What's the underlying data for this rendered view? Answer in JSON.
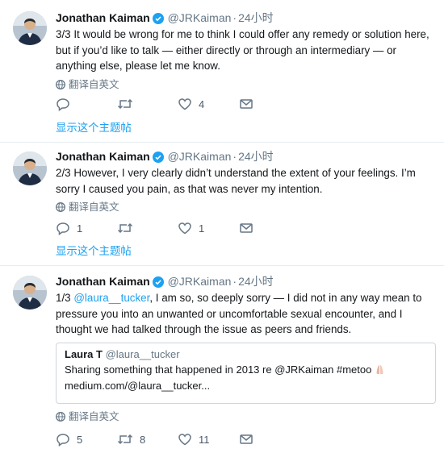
{
  "tweets": [
    {
      "name": "Jonathan Kaiman",
      "handle": "@JRKaiman",
      "time": "24小时",
      "text": "3/3 It would be wrong for me to think I could offer any remedy or solution here, but if you’d like to talk — either directly or through an intermediary — or anything else, please let me know.",
      "translate": "翻译自英文",
      "reply_count": "",
      "retweet_count": "",
      "like_count": "4",
      "thread_link": "显示这个主题帖"
    },
    {
      "name": "Jonathan Kaiman",
      "handle": "@JRKaiman",
      "time": "24小时",
      "text": "2/3 However, I very clearly didn’t understand the extent of your feelings. I’m sorry I caused you pain, as that was never my intention.",
      "translate": "翻译自英文",
      "reply_count": "1",
      "retweet_count": "",
      "like_count": "1",
      "thread_link": "显示这个主题帖"
    },
    {
      "name": "Jonathan Kaiman",
      "handle": "@JRKaiman",
      "time": "24小时",
      "text_prefix": "1/3 ",
      "text_mention": "@laura__tucker",
      "text_rest": ", I am so, so deeply sorry — I did not in any way mean to pressure you into an unwanted or uncomfortable sexual encounter, and I thought we had talked through the issue as peers and friends.",
      "quote": {
        "name": "Laura T",
        "handle": "@laura__tucker",
        "line1": "Sharing something that happened in 2013 re @JRKaiman #metoo",
        "line2": "medium.com/@laura__tucker..."
      },
      "translate": "翻译自英文",
      "reply_count": "5",
      "retweet_count": "8",
      "like_count": "11"
    }
  ],
  "colors": {
    "accent": "#1da1f2",
    "muted": "#657786",
    "divider": "#e6ecf0"
  },
  "icons": [
    "avatar",
    "verified-badge-icon",
    "globe-icon",
    "reply-icon",
    "retweet-icon",
    "like-icon",
    "message-icon"
  ]
}
